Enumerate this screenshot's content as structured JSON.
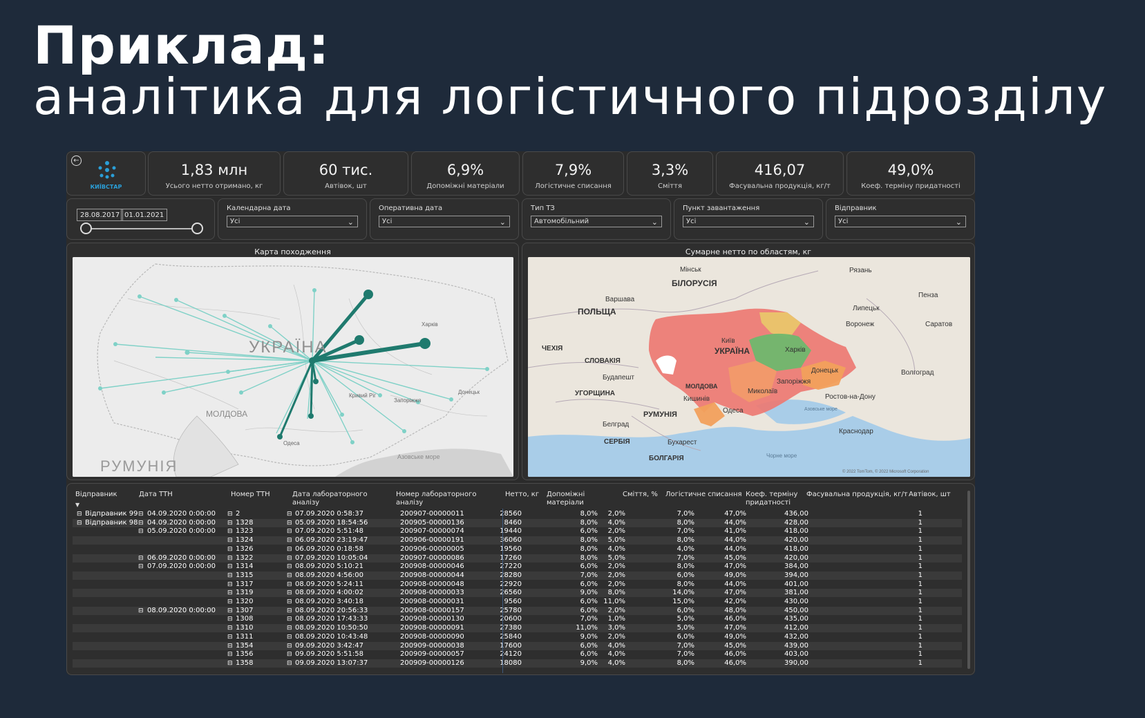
{
  "slide": {
    "title_bold": "Приклад:",
    "title_rest": "аналітика для логістичного підрозділу"
  },
  "header": {
    "logo_text": "КИЇВСТАР",
    "back_icon": "back-arrow-icon",
    "kpis": [
      {
        "value": "1,83 млн",
        "label": "Усього нетто отримано, кг"
      },
      {
        "value": "60 тис.",
        "label": "Автівок, шт"
      },
      {
        "value": "6,9%",
        "label": "Допоміжні матеріали"
      },
      {
        "value": "7,9%",
        "label": "Логістичне списання"
      },
      {
        "value": "3,3%",
        "label": "Сміття"
      },
      {
        "value": "416,07",
        "label": "Фасувальна продукція, кг/т"
      },
      {
        "value": "49,0%",
        "label": "Коеф. терміну придатності"
      }
    ]
  },
  "filters": {
    "date_from": "28.08.2017",
    "date_to": "01.01.2021",
    "slicers": [
      {
        "title": "Календарна дата",
        "value": "Усі"
      },
      {
        "title": "Оперативна дата",
        "value": "Усі"
      },
      {
        "title": "Тип ТЗ",
        "value": "Автомобільний"
      },
      {
        "title": "Пункт завантаження",
        "value": "Усі"
      },
      {
        "title": "Відправник",
        "value": "Усі"
      }
    ]
  },
  "map_left": {
    "title": "Карта походження",
    "labels": {
      "ukraine": "УКРАЇНА",
      "moldova": "МОЛДОВА",
      "romania": "РУМУНІЯ",
      "azov": "Азовське море",
      "kharkiv": "Харків",
      "zaporizhzhia": "Запоріжжя",
      "odesa": "Одеса",
      "kryvyi": "Кривий Ріг",
      "donetsk": "Донецьк"
    }
  },
  "map_right": {
    "title": "Сумарне нетто по областям, кг",
    "labels": {
      "belarus": "БІЛОРУСІЯ",
      "poland": "ПОЛЬЩА",
      "ukraine": "УКРАЇНА",
      "czechia": "ЧЕХІЯ",
      "slovakia": "СЛОВАКІЯ",
      "hungary": "УГОРЩИНА",
      "moldova": "МОЛДОВА",
      "romania": "РУМУНІЯ",
      "serbia": "СЕРБІЯ",
      "bulgaria": "БОЛГАРІЯ",
      "minsk": "Мінськ",
      "warsaw": "Варшава",
      "kyiv": "Київ",
      "kharkiv": "Харків",
      "donetsk": "Донецьк",
      "mykolaiv": "Миколаїв",
      "zaporizhzhia": "Запоріжжя",
      "odesa": "Одеса",
      "kishinev": "Кишинів",
      "bucharest": "Бухарест",
      "belgrade": "Белград",
      "budapest": "Будапешт",
      "rostov": "Ростов-на-Дону",
      "voronezh": "Воронеж",
      "krasnodar": "Краснодар",
      "volgograd": "Волгоград",
      "saratov": "Саратов",
      "penza": "Пенза",
      "lipetsk": "Липецьк",
      "ryazan": "Рязань",
      "black_sea": "Чорне море",
      "azov": "Азовське море",
      "attribution": "© 2022 TomTom, © 2022 Microsoft Corporation"
    }
  },
  "table": {
    "headers": [
      "Відправник",
      "Дата ТТН",
      "Номер ТТН",
      "Дата лабораторного аналізу",
      "Номер лабораторного аналізу",
      "Нетто, кг",
      "Допоміжні матеріали",
      "Сміття, %",
      "Логістичне списання",
      "Коеф. терміну придатності",
      "Фасувальна продукція, кг/т",
      "Автівок, шт"
    ],
    "rows": [
      {
        "sender": "Відправник 99",
        "date": "04.09.2020 0:00:00",
        "ttn": "2",
        "lab_date": "07.09.2020 0:58:37",
        "lab_no": "200907-00000011",
        "net": "28560",
        "aux": "8,0%",
        "trash": "2,0%",
        "log": "7,0%",
        "coef": "47,0%",
        "pack": "436,00",
        "cars": "1"
      },
      {
        "sender": "Відправник 98",
        "date": "04.09.2020 0:00:00",
        "ttn": "1328",
        "lab_date": "05.09.2020 18:54:56",
        "lab_no": "200905-00000136",
        "net": "8460",
        "aux": "8,0%",
        "trash": "4,0%",
        "log": "8,0%",
        "coef": "44,0%",
        "pack": "428,00",
        "cars": "1"
      },
      {
        "sender": "",
        "date": "05.09.2020 0:00:00",
        "ttn": "1323",
        "lab_date": "07.09.2020 5:51:48",
        "lab_no": "200907-00000074",
        "net": "19440",
        "aux": "6,0%",
        "trash": "2,0%",
        "log": "7,0%",
        "coef": "41,0%",
        "pack": "418,00",
        "cars": "1"
      },
      {
        "sender": "",
        "date": "",
        "ttn": "1324",
        "lab_date": "06.09.2020 23:19:47",
        "lab_no": "200906-00000191",
        "net": "36060",
        "aux": "8,0%",
        "trash": "5,0%",
        "log": "8,0%",
        "coef": "44,0%",
        "pack": "420,00",
        "cars": "1"
      },
      {
        "sender": "",
        "date": "",
        "ttn": "1326",
        "lab_date": "06.09.2020 0:18:58",
        "lab_no": "200906-00000005",
        "net": "19560",
        "aux": "8,0%",
        "trash": "4,0%",
        "log": "4,0%",
        "coef": "44,0%",
        "pack": "418,00",
        "cars": "1"
      },
      {
        "sender": "",
        "date": "06.09.2020 0:00:00",
        "ttn": "1322",
        "lab_date": "07.09.2020 10:05:04",
        "lab_no": "200907-00000086",
        "net": "17260",
        "aux": "8,0%",
        "trash": "5,0%",
        "log": "7,0%",
        "coef": "45,0%",
        "pack": "420,00",
        "cars": "1"
      },
      {
        "sender": "",
        "date": "07.09.2020 0:00:00",
        "ttn": "1314",
        "lab_date": "08.09.2020 5:10:21",
        "lab_no": "200908-00000046",
        "net": "27220",
        "aux": "6,0%",
        "trash": "2,0%",
        "log": "8,0%",
        "coef": "47,0%",
        "pack": "384,00",
        "cars": "1"
      },
      {
        "sender": "",
        "date": "",
        "ttn": "1315",
        "lab_date": "08.09.2020 4:56:00",
        "lab_no": "200908-00000044",
        "net": "28280",
        "aux": "7,0%",
        "trash": "2,0%",
        "log": "6,0%",
        "coef": "49,0%",
        "pack": "394,00",
        "cars": "1"
      },
      {
        "sender": "",
        "date": "",
        "ttn": "1317",
        "lab_date": "08.09.2020 5:24:11",
        "lab_no": "200908-00000048",
        "net": "22920",
        "aux": "6,0%",
        "trash": "2,0%",
        "log": "8,0%",
        "coef": "44,0%",
        "pack": "401,00",
        "cars": "1"
      },
      {
        "sender": "",
        "date": "",
        "ttn": "1319",
        "lab_date": "08.09.2020 4:00:02",
        "lab_no": "200908-00000033",
        "net": "26560",
        "aux": "9,0%",
        "trash": "8,0%",
        "log": "14,0%",
        "coef": "47,0%",
        "pack": "381,00",
        "cars": "1"
      },
      {
        "sender": "",
        "date": "",
        "ttn": "1320",
        "lab_date": "08.09.2020 3:40:18",
        "lab_no": "200908-00000031",
        "net": "9560",
        "aux": "6,0%",
        "trash": "11,0%",
        "log": "15,0%",
        "coef": "42,0%",
        "pack": "430,00",
        "cars": "1"
      },
      {
        "sender": "",
        "date": "08.09.2020 0:00:00",
        "ttn": "1307",
        "lab_date": "08.09.2020 20:56:33",
        "lab_no": "200908-00000157",
        "net": "25780",
        "aux": "6,0%",
        "trash": "2,0%",
        "log": "6,0%",
        "coef": "48,0%",
        "pack": "450,00",
        "cars": "1"
      },
      {
        "sender": "",
        "date": "",
        "ttn": "1308",
        "lab_date": "08.09.2020 17:43:33",
        "lab_no": "200908-00000130",
        "net": "20600",
        "aux": "7,0%",
        "trash": "1,0%",
        "log": "5,0%",
        "coef": "46,0%",
        "pack": "435,00",
        "cars": "1"
      },
      {
        "sender": "",
        "date": "",
        "ttn": "1310",
        "lab_date": "08.09.2020 10:50:50",
        "lab_no": "200908-00000091",
        "net": "27380",
        "aux": "11,0%",
        "trash": "3,0%",
        "log": "5,0%",
        "coef": "47,0%",
        "pack": "412,00",
        "cars": "1"
      },
      {
        "sender": "",
        "date": "",
        "ttn": "1311",
        "lab_date": "08.09.2020 10:43:48",
        "lab_no": "200908-00000090",
        "net": "25840",
        "aux": "9,0%",
        "trash": "2,0%",
        "log": "6,0%",
        "coef": "49,0%",
        "pack": "432,00",
        "cars": "1"
      },
      {
        "sender": "",
        "date": "",
        "ttn": "1354",
        "lab_date": "09.09.2020 3:42:47",
        "lab_no": "200909-00000038",
        "net": "17600",
        "aux": "6,0%",
        "trash": "4,0%",
        "log": "7,0%",
        "coef": "45,0%",
        "pack": "439,00",
        "cars": "1"
      },
      {
        "sender": "",
        "date": "",
        "ttn": "1356",
        "lab_date": "09.09.2020 5:51:58",
        "lab_no": "200909-00000057",
        "net": "24120",
        "aux": "6,0%",
        "trash": "4,0%",
        "log": "7,0%",
        "coef": "46,0%",
        "pack": "403,00",
        "cars": "1"
      },
      {
        "sender": "",
        "date": "",
        "ttn": "1358",
        "lab_date": "09.09.2020 13:07:37",
        "lab_no": "200909-00000126",
        "net": "18080",
        "aux": "9,0%",
        "trash": "4,0%",
        "log": "8,0%",
        "coef": "46,0%",
        "pack": "390,00",
        "cars": "1"
      }
    ]
  }
}
